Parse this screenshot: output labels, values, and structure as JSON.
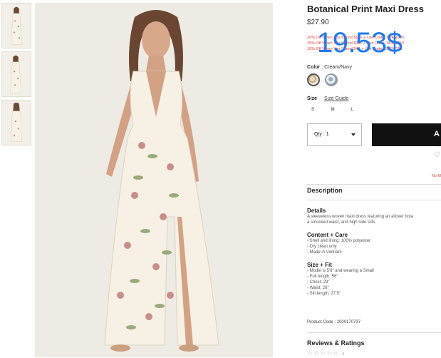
{
  "product": {
    "title": "Botanical Print Maxi Dress",
    "price": "$27.90",
    "overlay_price": "19.53$"
  },
  "promos": [
    "20% Off When You Spend $150 + Use Code: SPEND20",
    "15% Off When You Spend $100 + Use Code: SPEND15",
    "10% Off When You Spend $40 + Use Code: SPEND10"
  ],
  "color": {
    "label": "Color",
    "value": ": Cream/Navy",
    "swatches": [
      "Cream",
      "Navy"
    ]
  },
  "size": {
    "label": "Size",
    "guide_label": "Size Guide",
    "options": [
      "S",
      "M",
      "L"
    ]
  },
  "quantity": {
    "label": "Qty : 1"
  },
  "add_button": {
    "label": "A"
  },
  "wishlist": {
    "icon": "heart-icon",
    "symbol": "♡"
  },
  "not_mine": {
    "label": "No M"
  },
  "description": {
    "title": "Description",
    "details_title": "Details",
    "details_lines": [
      "A sleeveless woven maxi dress featuring an allover bota",
      "a smocked waist, and high side slits."
    ],
    "content_title": "Content + Care",
    "content_lines": [
      "- Shell and lining: 100% polyester",
      "- Dry clean only",
      "- Made in Vietnam"
    ],
    "fit_title": "Size + Fit",
    "fit_lines": [
      "- Model is 5'8\" and wearing a Small",
      "- Full length: 56\"",
      "- Chest: 29\"",
      "- Waist: 26\"",
      "- Slit length: 27.5\""
    ],
    "product_code": "Product Code : 2000170737"
  },
  "reviews": {
    "title": "Reviews & Ratings",
    "stars": "☆☆☆☆☆",
    "count": "0"
  },
  "colors": {
    "promo_red": "#e23b3b",
    "overlay_blue": "#1e7bf0",
    "button_black": "#111111"
  }
}
